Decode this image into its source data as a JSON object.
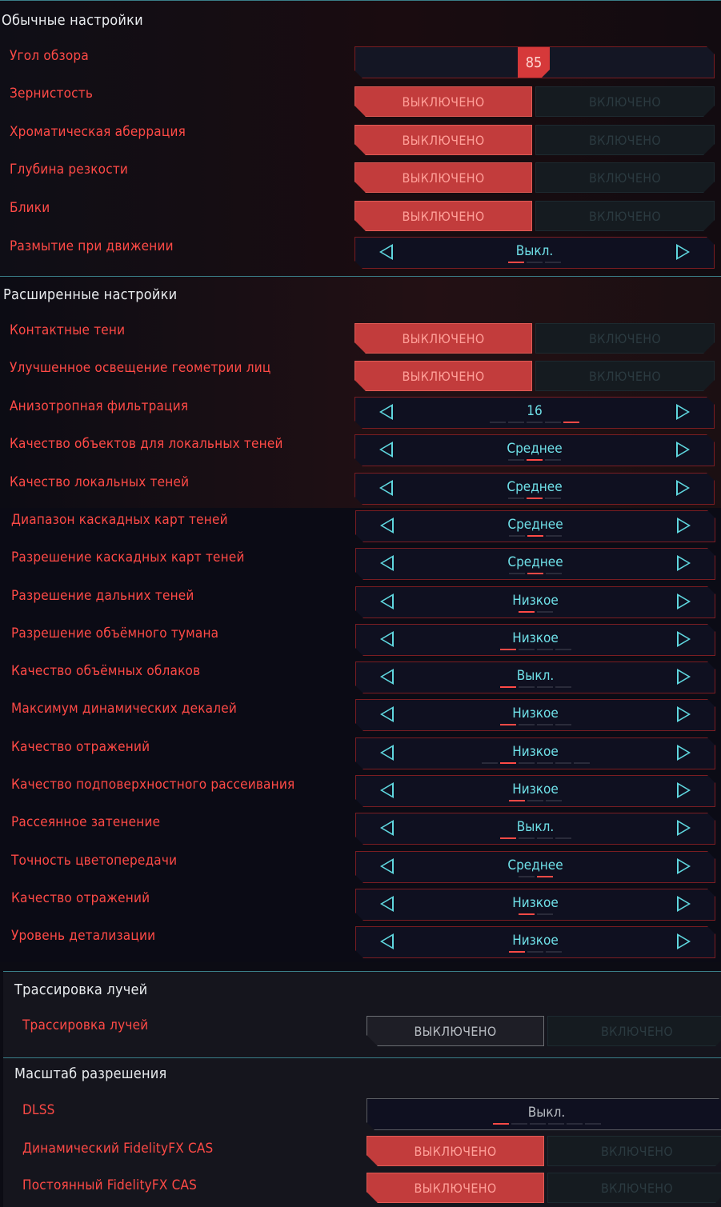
{
  "basic": {
    "title": "Обычные настройки",
    "fov": {
      "label": "Угол обзора",
      "value": "85",
      "level": 0.45
    },
    "toggles": [
      {
        "label": "Зернистость",
        "off": "ВЫКЛЮЧЕНО",
        "on": "ВКЛЮЧЕНО"
      },
      {
        "label": "Хроматическая аберрация",
        "off": "ВЫКЛЮЧЕНО",
        "on": "ВКЛЮЧЕНО"
      },
      {
        "label": "Глубина резкости",
        "off": "ВЫКЛЮЧЕНО",
        "on": "ВКЛЮЧЕНО"
      },
      {
        "label": "Блики",
        "off": "ВЫКЛЮЧЕНО",
        "on": "ВКЛЮЧЕНО"
      }
    ],
    "motion_blur": {
      "label": "Размытие при движении",
      "value": "Выкл.",
      "steps": 3,
      "active": 0
    }
  },
  "advanced": {
    "title": "Расширенные настройки",
    "toggles": [
      {
        "label": "Контактные тени",
        "off": "ВЫКЛЮЧЕНО",
        "on": "ВКЛЮЧЕНО"
      },
      {
        "label": "Улучшенное освещение геометрии лиц",
        "off": "ВЫКЛЮЧЕНО",
        "on": "ВКЛЮЧЕНО"
      }
    ],
    "selectors": [
      {
        "label": "Анизотропная фильтрация",
        "value": "16",
        "steps": 5,
        "active": 4
      },
      {
        "label": "Качество объектов для локальных теней",
        "value": "Среднее",
        "steps": 3,
        "active": 1
      },
      {
        "label": "Качество локальных теней",
        "value": "Среднее",
        "steps": 3,
        "active": 1
      },
      {
        "label": "Диапазон каскадных карт теней",
        "value": "Среднее",
        "steps": 3,
        "active": 1
      },
      {
        "label": "Разрешение каскадных карт теней",
        "value": "Среднее",
        "steps": 3,
        "active": 1
      },
      {
        "label": "Разрешение дальних теней",
        "value": "Низкое",
        "steps": 2,
        "active": 0
      },
      {
        "label": "Разрешение объёмного тумана",
        "value": "Низкое",
        "steps": 4,
        "active": 0
      },
      {
        "label": "Качество объёмных облаков",
        "value": "Выкл.",
        "steps": 4,
        "active": 0
      },
      {
        "label": "Максимум динамических декалей",
        "value": "Низкое",
        "steps": 4,
        "active": 0
      },
      {
        "label": "Качество отражений",
        "value": "Низкое",
        "steps": 6,
        "active": 1
      },
      {
        "label": "Качество подповерхностного рассеивания",
        "value": "Низкое",
        "steps": 3,
        "active": 0
      },
      {
        "label": "Рассеянное затенение",
        "value": "Выкл.",
        "steps": 4,
        "active": 0
      },
      {
        "label": "Точность цветопередачи",
        "value": "Среднее",
        "steps": 2,
        "active": 1
      },
      {
        "label": "Качество отражений",
        "value": "Низкое",
        "steps": 2,
        "active": 0
      },
      {
        "label": "Уровень детализации",
        "value": "Низкое",
        "steps": 3,
        "active": 0
      }
    ]
  },
  "raytracing": {
    "title": "Трассировка лучей",
    "toggle": {
      "label": "Трассировка лучей",
      "off": "ВЫКЛЮЧЕНО",
      "on": "ВКЛЮЧЕНО"
    }
  },
  "resolution": {
    "title": "Масштаб разрешения",
    "dlss": {
      "label": "DLSS",
      "value": "Выкл.",
      "steps": 6,
      "active": 0
    },
    "toggles": [
      {
        "label": "Динамический FidelityFX CAS",
        "off": "ВЫКЛЮЧЕНО",
        "on": "ВКЛЮЧЕНО"
      },
      {
        "label": "Постоянный FidelityFX CAS",
        "off": "ВЫКЛЮЧЕНО",
        "on": "ВКЛЮЧЕНО"
      }
    ]
  }
}
